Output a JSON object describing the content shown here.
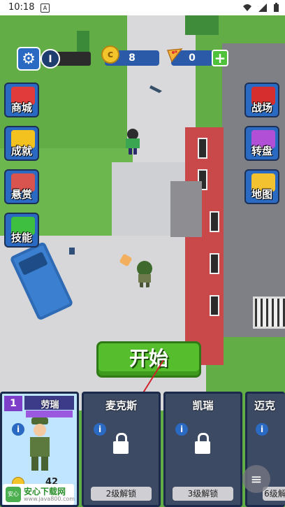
{
  "status_bar": {
    "time": "10:18",
    "sim_icon": "A"
  },
  "hud": {
    "level": "I",
    "coins": "8",
    "pizza": "0",
    "plus": "+"
  },
  "left_menu": [
    {
      "label": "商城",
      "icon": "shop-cart-icon",
      "color": "#e23b3b"
    },
    {
      "label": "成就",
      "icon": "trophy-icon",
      "color": "#f4c21f"
    },
    {
      "label": "悬赏",
      "icon": "wanted-zombie-icon",
      "color": "#d9534f"
    },
    {
      "label": "技能",
      "icon": "skill-arrows-icon",
      "color": "#3fbf3f"
    }
  ],
  "right_menu": [
    {
      "label": "战场",
      "icon": "battle-flag-icon",
      "color": "#d62e2e"
    },
    {
      "label": "转盘",
      "icon": "wheel-icon",
      "color": "#b14fd6"
    },
    {
      "label": "地图",
      "icon": "crown-map-icon",
      "color": "#f2c230"
    }
  ],
  "start_button": "开始",
  "characters": [
    {
      "name": "劳瑞",
      "level": "1",
      "price": "42",
      "locked": false
    },
    {
      "name": "麦克斯",
      "unlock": "2级解锁",
      "locked": true
    },
    {
      "name": "凯瑞",
      "unlock": "3级解锁",
      "locked": true
    },
    {
      "name": "迈克",
      "unlock": "6级解",
      "locked": true
    }
  ],
  "watermark": {
    "logo": "安心",
    "title": "安心下载网",
    "sub": "www.java800.com"
  },
  "colors": {
    "start_green": "#56bd2d",
    "hud_blue": "#2b5aa8",
    "card_active": "#bfe5ff"
  }
}
